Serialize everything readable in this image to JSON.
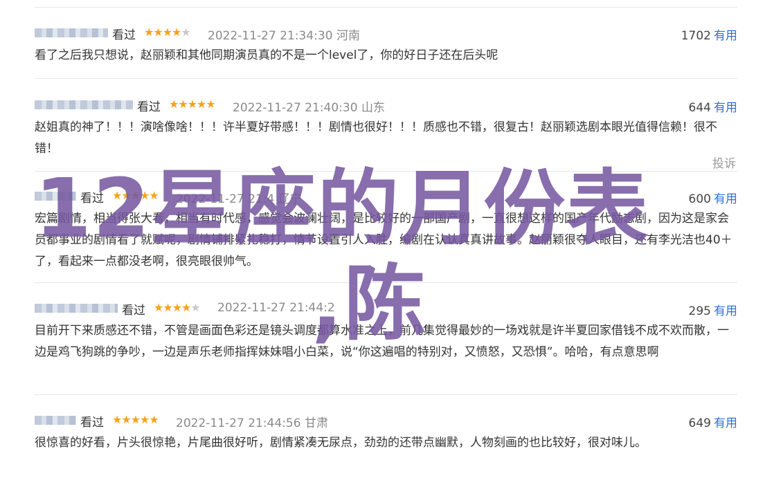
{
  "reviews": [
    {
      "seen": "看过",
      "stars": "★★★★",
      "stars_off": "★",
      "time": "2022-11-27 21:34:30 河南",
      "count": "1702",
      "useful": "有用",
      "text": "看了之后我只想说，赵丽颖和其他同期演员真的不是一个level了，你的好日子还在后头呢"
    },
    {
      "seen": "看过",
      "stars": "★★★★★",
      "stars_off": "",
      "time": "2022-11-27 21:40:30 山东",
      "count": "644",
      "useful": "有用",
      "text": "赵姐真的神了！！！演啥像啥！！！许半夏好带感！！！剧情也很好！！！质感也不错，很复古！赵丽颖选剧本眼光值得信赖！很不错！"
    },
    {
      "seen": "看过",
      "stars": "★★★★★",
      "stars_off": "",
      "time": "2022-11-27 21:4 辽宁",
      "count": "600",
      "useful": "有用",
      "text": "宏篇剧情，相当得张大看，相当有时代感，感觉会波澜壮阔，是比较好的一部国产剧，一直很想这样的国产年代励志剧，因为这是家会员都事业的剧情看了就赋呢，剧情铺排紧扎稳打，情节设置引人入胜，编剧在认认真真讲故事。赵丽颖很夺人眼目，还有李光洁也40＋了，看起来一点都没老啊，很亮眼很帅气。"
    },
    {
      "seen": "看过",
      "stars": "★★★★",
      "stars_off": "★",
      "time": "2022-11-27 21:44:2",
      "count": "295",
      "useful": "有用",
      "text": "目前开下来质感还不错，不管是画面色彩还是镜头调度都算水准之上，前几集觉得最妙的一场戏就是许半夏回家借钱不成不欢而散，一边是鸡飞狗跳的争吵，一边是声乐老师指挥妹妹唱小白菜，说“你这遍唱的特别对，又愤怒，又恐惧”。哈哈，有点意思啊"
    },
    {
      "seen": "看过",
      "stars": "★★★★★",
      "stars_off": "",
      "time": "2022-11-27 21:44:56 甘肃",
      "count": "649",
      "useful": "有用",
      "text": "很惊喜的好看，片头很惊艳，片尾曲很好听，剧情紧凑无尿点，劲劲的还带点幽默，人物刻画的也比较好，很对味儿。"
    }
  ],
  "report_label": "投诉",
  "watermark": {
    "line1": "12星座的月份表",
    "line2": ",陈"
  },
  "colors": {
    "star": "#f7a21b",
    "useful": "#2f6fd1",
    "watermark": "#7556a0"
  }
}
